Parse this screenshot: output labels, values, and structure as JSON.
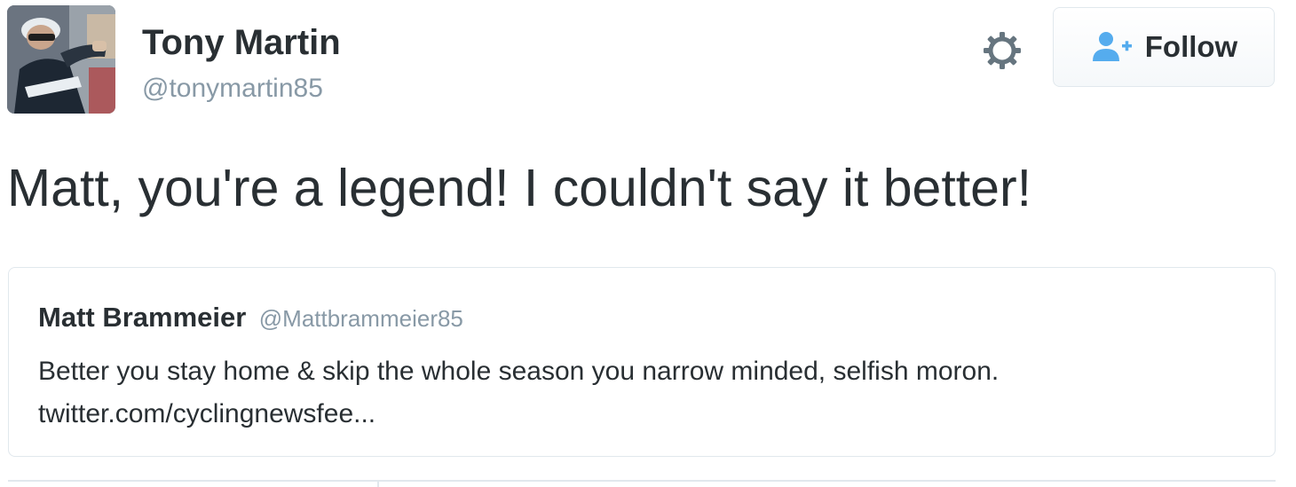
{
  "author": {
    "fullname": "Tony Martin",
    "screen_name": "@tonymartin85",
    "avatar_icon": "cyclist-avatar"
  },
  "actions": {
    "settings_icon": "gear-icon",
    "follow_icon": "add-user-icon",
    "follow_label": "Follow"
  },
  "tweet": {
    "text": "Matt, you're a legend! I couldn't say it better!"
  },
  "quoted_tweet": {
    "fullname": "Matt Brammeier",
    "screen_name": "@Mattbrammeier85",
    "text": "Better you stay home & skip the whole season you narrow minded, selfish moron.",
    "link": "twitter.com/cyclingnewsfee..."
  },
  "colors": {
    "text": "#292f33",
    "secondary": "#8899a6",
    "accent": "#55acee",
    "border": "#e1e8ed"
  }
}
